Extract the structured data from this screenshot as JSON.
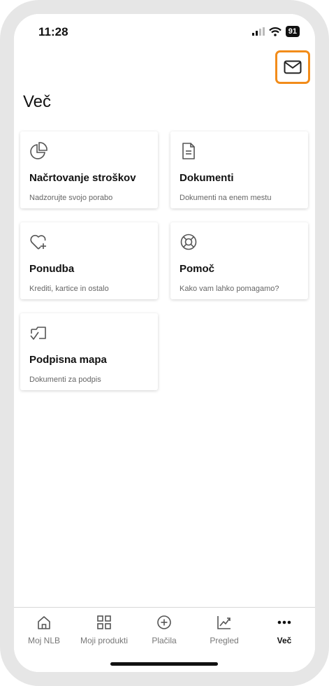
{
  "status_bar": {
    "time": "11:28",
    "battery": "91"
  },
  "header": {
    "title": "Več",
    "mail_icon": "mail-icon"
  },
  "cards": [
    {
      "icon": "pie-chart-icon",
      "title": "Načrtovanje stroškov",
      "subtitle": "Nadzorujte svojo porabo"
    },
    {
      "icon": "document-icon",
      "title": "Dokumenti",
      "subtitle": "Dokumenti na enem mestu"
    },
    {
      "icon": "heart-plus-icon",
      "title": "Ponudba",
      "subtitle": "Krediti, kartice in ostalo"
    },
    {
      "icon": "lifebuoy-icon",
      "title": "Pomoč",
      "subtitle": "Kako vam lahko pomagamo?"
    },
    {
      "icon": "signature-folder-icon",
      "title": "Podpisna mapa",
      "subtitle": "Dokumenti za podpis"
    }
  ],
  "tabbar": {
    "items": [
      {
        "label": "Moj NLB",
        "icon": "home-icon",
        "active": false
      },
      {
        "label": "Moji produkti",
        "icon": "grid-icon",
        "active": false
      },
      {
        "label": "Plačila",
        "icon": "plus-circle-icon",
        "active": false
      },
      {
        "label": "Pregled",
        "icon": "trend-chart-icon",
        "active": false
      },
      {
        "label": "Več",
        "icon": "more-dots-icon",
        "active": true
      }
    ]
  },
  "colors": {
    "highlight": "#f28c1a",
    "text": "#111111",
    "muted": "#666666"
  }
}
